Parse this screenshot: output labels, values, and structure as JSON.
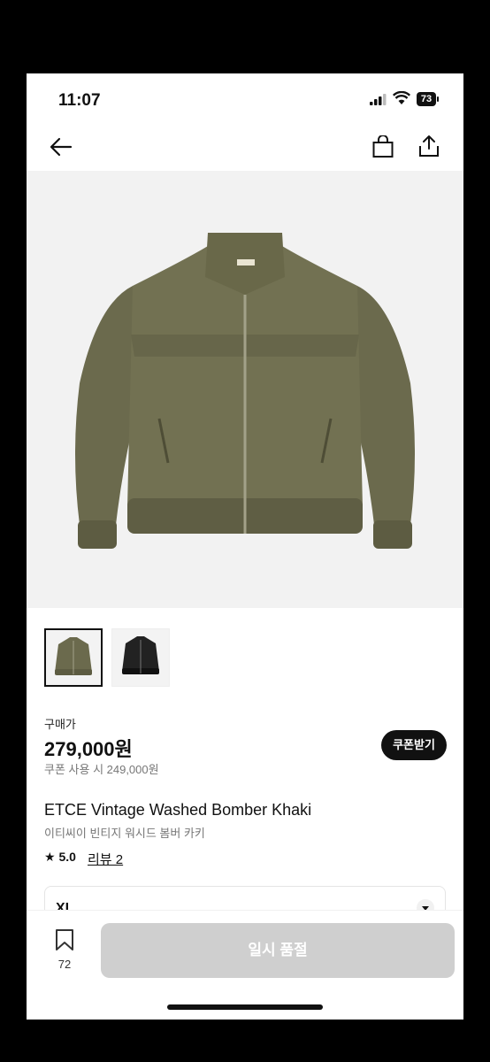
{
  "status": {
    "time": "11:07",
    "battery": "73"
  },
  "product": {
    "price_label": "구매가",
    "price": "279,000원",
    "coupon_price": "쿠폰 사용 시 249,000원",
    "coupon_button": "쿠폰받기",
    "name_en": "ETCE Vintage Washed Bomber Khaki",
    "name_ko": "이티씨이 빈티지 워시드 봄버 카키",
    "rating": "5.0",
    "reviews_label": "리뷰 2"
  },
  "thumbnails": [
    {
      "name": "khaki",
      "color": "#6b6a4d"
    },
    {
      "name": "black",
      "color": "#222222"
    }
  ],
  "option": {
    "selected": "XL"
  },
  "bottom": {
    "wish_count": "72",
    "soldout_label": "일시 품절"
  },
  "colors": {
    "jacket": "#6e6c4f",
    "accent": "#111111"
  }
}
